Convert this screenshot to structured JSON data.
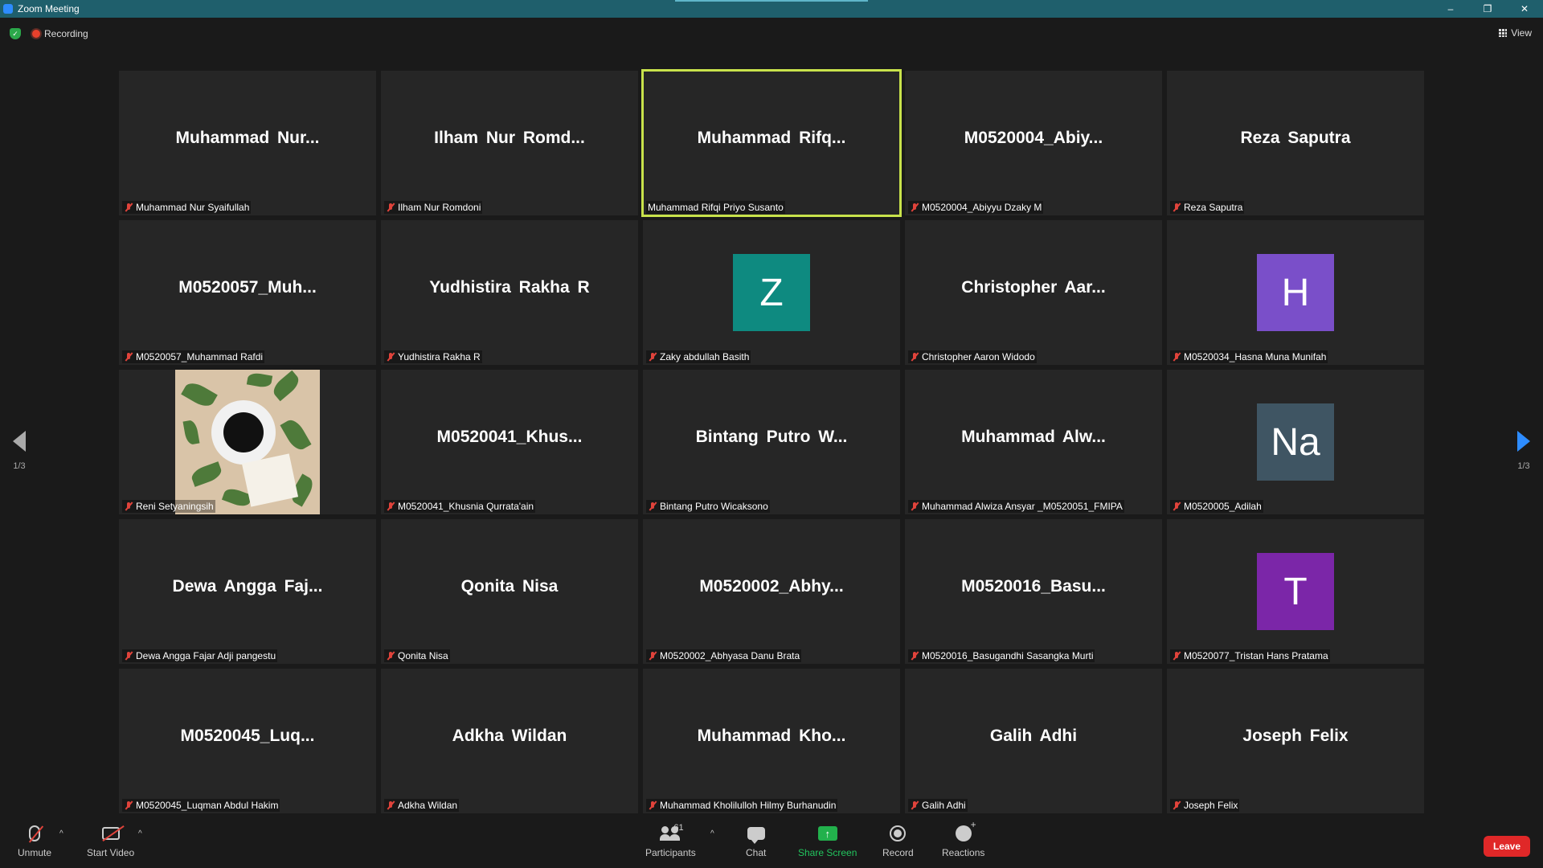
{
  "window": {
    "title": "Zoom Meeting",
    "minimize": "–",
    "restore": "❐",
    "close": "✕"
  },
  "topbar": {
    "recording_label": "Recording",
    "view_label": "View"
  },
  "pager": {
    "left_page": "1/3",
    "right_page": "1/3"
  },
  "participants_grid": [
    {
      "big": "Muhammad  Nur...",
      "label": "Muhammad Nur Syaifullah"
    },
    {
      "big": "Ilham  Nur  Romd...",
      "label": "Ilham Nur Romdoni"
    },
    {
      "big": "Muhammad  Rifq...",
      "label": "Muhammad Rifqi Priyo Susanto",
      "active": true
    },
    {
      "big": "M0520004_Abiy...",
      "label": "M0520004_Abiyyu Dzaky M"
    },
    {
      "big": "Reza Saputra",
      "label": "Reza Saputra"
    },
    {
      "big": "M0520057_Muh...",
      "label": "M0520057_Muhammad Rafdi"
    },
    {
      "big": "Yudhistira Rakha R",
      "label": "Yudhistira Rakha R"
    },
    {
      "avatar": "Z",
      "color": "#0e8a80",
      "label": "Zaky abdullah Basith"
    },
    {
      "big": "Christopher  Aar...",
      "label": "Christopher Aaron Widodo"
    },
    {
      "avatar": "H",
      "color": "#7a4fc9",
      "label": "M0520034_Hasna Muna Munifah"
    },
    {
      "photo": true,
      "label": "Reni Setyaningsih"
    },
    {
      "big": "M0520041_Khus...",
      "label": "M0520041_Khusnia Qurrata'ain"
    },
    {
      "big": "Bintang Putro W...",
      "label": "Bintang Putro Wicaksono"
    },
    {
      "big": "Muhammad  Alw...",
      "label": "Muhammad Alwiza Ansyar _M0520051_FMIPA"
    },
    {
      "avatar": "Na",
      "color": "#3f5563",
      "label": "M0520005_Adilah"
    },
    {
      "big": "Dewa  Angga  Faj...",
      "label": "Dewa Angga Fajar Adji pangestu"
    },
    {
      "big": "Qonita Nisa",
      "label": "Qonita Nisa"
    },
    {
      "big": "M0520002_Abhy...",
      "label": "M0520002_Abhyasa Danu Brata"
    },
    {
      "big": "M0520016_Basu...",
      "label": "M0520016_Basugandhi Sasangka Murti"
    },
    {
      "avatar": "T",
      "color": "#7b26a8",
      "label": "M0520077_Tristan Hans Pratama"
    },
    {
      "big": "M0520045_Luq...",
      "label": "M0520045_Luqman Abdul Hakim"
    },
    {
      "big": "Adkha Wildan",
      "label": "Adkha Wildan"
    },
    {
      "big": "Muhammad  Kho...",
      "label": "Muhammad Kholilulloh Hilmy Burhanudin"
    },
    {
      "big": "Galih Adhi",
      "label": "Galih Adhi"
    },
    {
      "big": "Joseph Felix",
      "label": "Joseph Felix"
    }
  ],
  "toolbar": {
    "unmute": "Unmute",
    "start_video": "Start Video",
    "participants": "Participants",
    "participant_count": "61",
    "chat": "Chat",
    "share_screen": "Share Screen",
    "record": "Record",
    "reactions": "Reactions",
    "leave": "Leave",
    "caret": "^",
    "share_arrow": "↑"
  },
  "colors": {
    "active_speaker_border": "#c8e24b",
    "leave": "#e02828",
    "share_green": "#22b14c",
    "titlebar": "#1f5f6c"
  }
}
